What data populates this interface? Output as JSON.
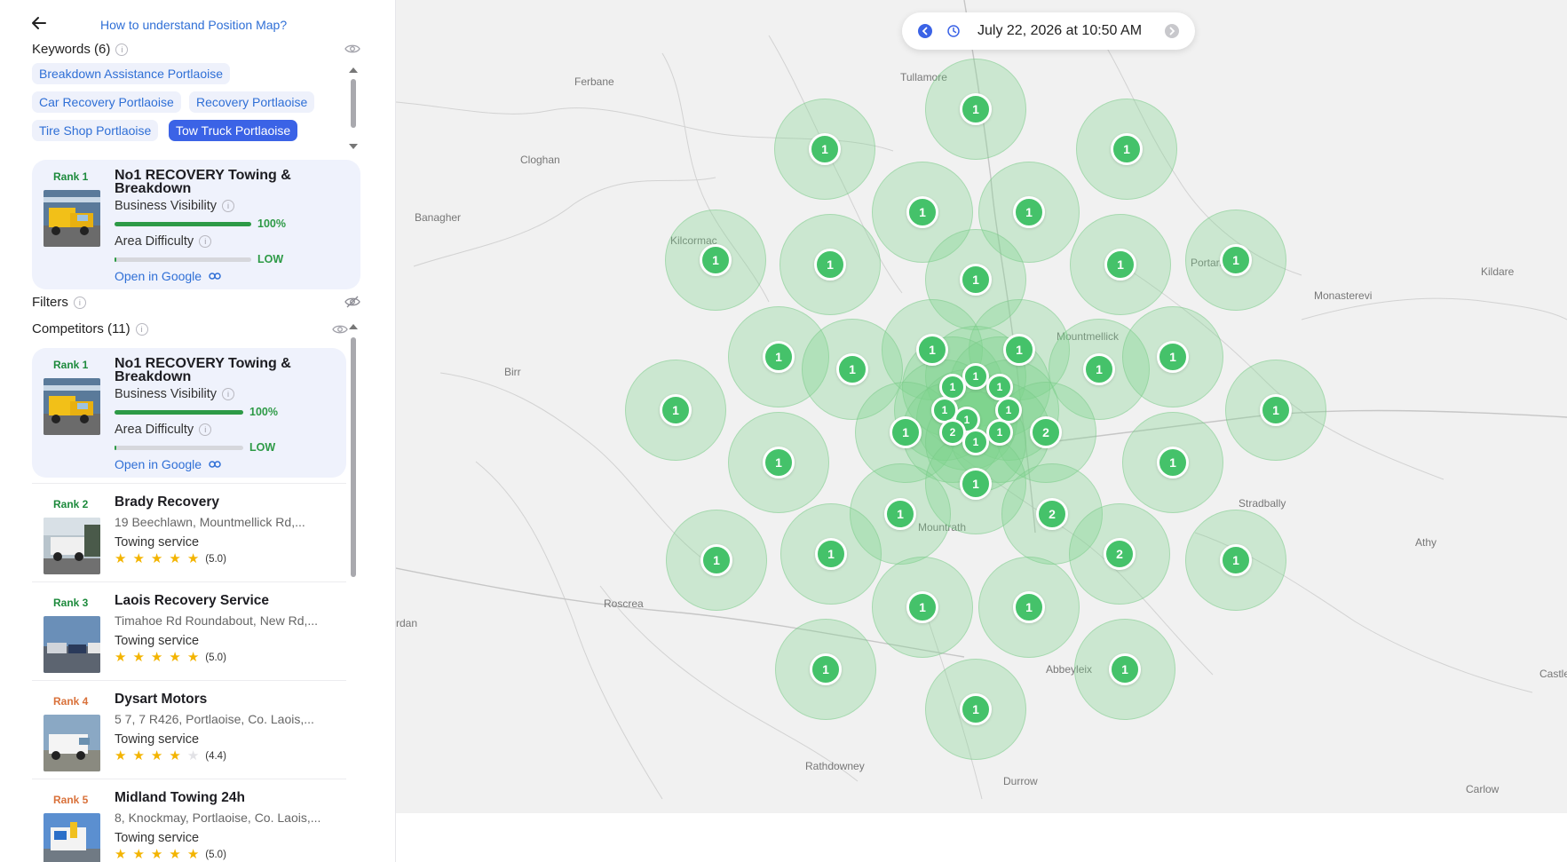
{
  "header": {
    "back_label": "",
    "help_link": "How to understand Position Map?"
  },
  "keywords": {
    "label": "Keywords (6)",
    "chips": [
      "Breakdown Assistance Portlaoise",
      "Car Recovery Portlaoise",
      "Recovery Portlaoise",
      "Tire Shop Portlaoise",
      "Tow Truck Portlaoise"
    ],
    "active_index": 4
  },
  "selected_business": {
    "rank": "Rank 1",
    "name_line1": "No1 RECOVERY Towing &",
    "name_line2": "Breakdown",
    "visibility_label": "Business Visibility",
    "visibility_value": "100%",
    "visibility_fraction": 1.0,
    "difficulty_label": "Area Difficulty",
    "difficulty_value": "LOW",
    "difficulty_fraction": 0.01,
    "open_link": "Open in Google"
  },
  "filters": {
    "label": "Filters"
  },
  "competitors": {
    "label": "Competitors (11)",
    "top": {
      "rank": "Rank 1",
      "name_line1": "No1 RECOVERY Towing &",
      "name_line2": "Breakdown",
      "visibility_label": "Business Visibility",
      "visibility_value": "100%",
      "visibility_fraction": 1.0,
      "difficulty_label": "Area Difficulty",
      "difficulty_value": "LOW",
      "difficulty_fraction": 0.01,
      "open_link": "Open in Google"
    },
    "items": [
      {
        "rank": "Rank 2",
        "name": "Brady Recovery",
        "address": "19 Beechlawn, Mountmellick Rd,...",
        "category": "Towing service",
        "stars": 5,
        "rating": "(5.0)",
        "rank_color": "green"
      },
      {
        "rank": "Rank 3",
        "name": "Laois Recovery Service",
        "address": "Timahoe Rd Roundabout, New Rd,...",
        "category": "Towing service",
        "stars": 5,
        "rating": "(5.0)",
        "rank_color": "green"
      },
      {
        "rank": "Rank 4",
        "name": "Dysart Motors",
        "address": "5 7, 7 R426, Portlaoise, Co. Laois,...",
        "category": "Towing service",
        "stars": 4,
        "rating": "(4.4)",
        "rank_color": "orange"
      },
      {
        "rank": "Rank 5",
        "name": "Midland Towing 24h",
        "address": "8, Knockmay, Portlaoise, Co. Laois,...",
        "category": "Towing service",
        "stars": 5,
        "rating": "(5.0)",
        "rank_color": "orange"
      }
    ]
  },
  "map": {
    "datetime": "July 22, 2026 at 10:50 AM",
    "towns": [
      "Tullamore",
      "Ferbane",
      "Cloghan",
      "Banagher",
      "Kilcormac",
      "Portarlington",
      "Kildare",
      "Monasterevi",
      "Mountmellick",
      "Birr",
      "Stradbally",
      "Athy",
      "Mountrath",
      "Roscrea",
      "rdan",
      "Abbeyleix",
      "Castle",
      "Rathdowney",
      "Durrow",
      "Carlow"
    ],
    "ranks": [
      "1",
      "1",
      "1",
      "1",
      "1",
      "1",
      "1",
      "1",
      "1",
      "1",
      "1",
      "1",
      "1",
      "1",
      "1",
      "1",
      "1",
      "1",
      "1",
      "1",
      "1",
      "1",
      "1",
      "1",
      "1",
      "2",
      "2",
      "1",
      "1",
      "1",
      "1",
      "1",
      "1",
      "1",
      "1",
      "1",
      "1",
      "1",
      "1",
      "1",
      "1",
      "1",
      "1",
      "1",
      "1",
      "1"
    ]
  },
  "colors": {
    "accent": "#3b63e6",
    "link": "#2f6fd6",
    "pin": "#45c26a",
    "card_bg": "#eff2fc"
  }
}
